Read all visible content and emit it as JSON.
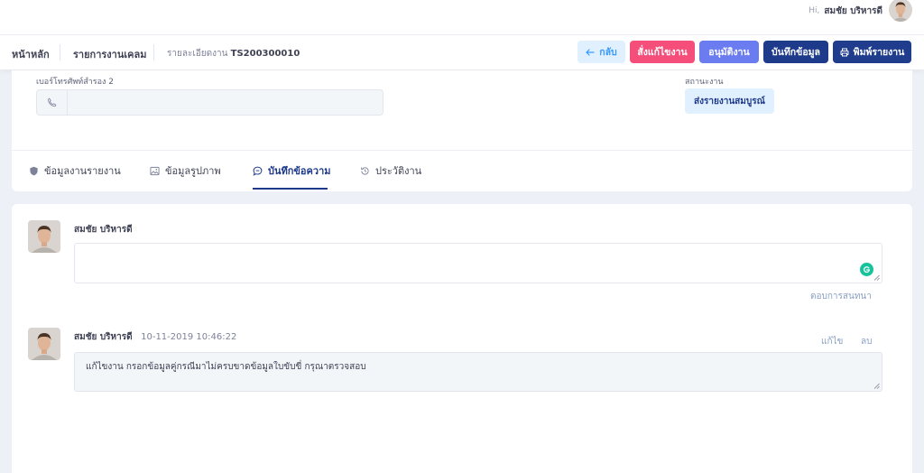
{
  "user": {
    "greeting": "Hi,",
    "name": "สมชัย บริหารดี"
  },
  "breadcrumb": {
    "home": "หน้าหลัก",
    "list": "รายการงานเคลม",
    "detail_prefix": "รายละเอียดงาน",
    "job_id": "TS200300010"
  },
  "toolbar": {
    "back": "กลับ",
    "fix": "สั่งแก้ไขงาน",
    "approve": "อนุมัติงาน",
    "save": "บันทึกข้อมูล",
    "print": "พิมพ์รายงาน"
  },
  "form": {
    "phone2_label": "เบอร์โทรศัพท์สำรอง 2",
    "phone2_value": "",
    "status_label": "สถานะงาน",
    "status_value": "ส่งรายงานสมบูรณ์"
  },
  "tabs": [
    {
      "label": "ข้อมูลงานรายงาน",
      "icon": "shield-icon",
      "active": false
    },
    {
      "label": "ข้อมูลรูปภาพ",
      "icon": "image-icon",
      "active": false
    },
    {
      "label": "บันทึกข้อความ",
      "icon": "chat-icon",
      "active": true
    },
    {
      "label": "ประวัติงาน",
      "icon": "history-icon",
      "active": false
    }
  ],
  "reply": {
    "author": "สมชัย บริหารดี",
    "placeholder": "",
    "submit_label": "ตอบการสนทนา"
  },
  "messages": [
    {
      "author": "สมชัย บริหารดี",
      "timestamp": "10-11-2019 10:46:22",
      "text": "แก้ไขงาน กรอกข้อมูลคู่กรณีมาไม่ครบขาดข้อมูลใบขับขี่ กรุณาตรวจสอบ",
      "edit_label": "แก้ไข",
      "delete_label": "ลบ"
    }
  ],
  "colors": {
    "primary": "#1e3a8a",
    "danger": "#f64e7a",
    "approve": "#6b7cf0",
    "back_bg": "#e1f0ff",
    "grammarly": "#15c39a"
  }
}
